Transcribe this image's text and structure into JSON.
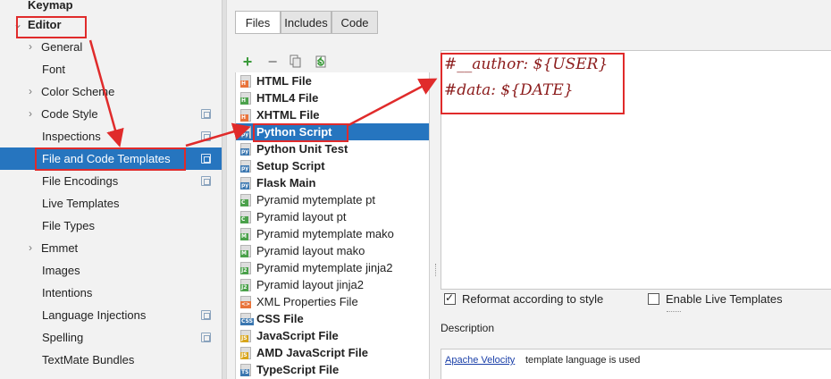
{
  "sidebar": {
    "items": [
      {
        "label": "Keymap",
        "bold": true
      },
      {
        "label": "Editor",
        "bold": true
      },
      {
        "label": "General",
        "chevron": true
      },
      {
        "label": "Font"
      },
      {
        "label": "Color Scheme",
        "chevron": true
      },
      {
        "label": "Code Style",
        "chevron": true,
        "copy_icon": true
      },
      {
        "label": "Inspections",
        "copy_icon": true
      },
      {
        "label": "File and Code Templates",
        "copy_icon": true,
        "selected": true
      },
      {
        "label": "File Encodings",
        "copy_icon": true
      },
      {
        "label": "Live Templates"
      },
      {
        "label": "File Types"
      },
      {
        "label": "Emmet",
        "chevron": true
      },
      {
        "label": "Images"
      },
      {
        "label": "Intentions"
      },
      {
        "label": "Language Injections",
        "copy_icon": true
      },
      {
        "label": "Spelling",
        "copy_icon": true
      },
      {
        "label": "TextMate Bundles"
      }
    ]
  },
  "tabs": [
    {
      "label": "Files",
      "active": true
    },
    {
      "label": "Includes"
    },
    {
      "label": "Code"
    }
  ],
  "toolbar": {
    "add_icon": "plus-icon",
    "remove_icon": "minus-icon",
    "copy_icon": "copy-icon",
    "reset_icon": "reset-icon"
  },
  "templates": [
    {
      "label": "HTML File",
      "bold": true,
      "badge": "H",
      "badge_color": "#e8733a"
    },
    {
      "label": "HTML4 File",
      "bold": true,
      "badge": "H",
      "badge_color": "#4ba14b"
    },
    {
      "label": "XHTML File",
      "bold": true,
      "badge": "H",
      "badge_color": "#e8733a"
    },
    {
      "label": "Python Script",
      "bold": true,
      "badge": "py",
      "badge_color": "#3b77b0",
      "selected": true
    },
    {
      "label": "Python Unit Test",
      "bold": true,
      "badge": "py",
      "badge_color": "#3b77b0"
    },
    {
      "label": "Setup Script",
      "bold": true,
      "badge": "py",
      "badge_color": "#3b77b0"
    },
    {
      "label": "Flask Main",
      "bold": true,
      "badge": "py",
      "badge_color": "#3b77b0"
    },
    {
      "label": "Pyramid mytemplate pt",
      "badge": "C",
      "badge_color": "#4ba14b"
    },
    {
      "label": "Pyramid layout pt",
      "badge": "C",
      "badge_color": "#4ba14b"
    },
    {
      "label": "Pyramid mytemplate mako",
      "badge": "M",
      "badge_color": "#4ba14b"
    },
    {
      "label": "Pyramid layout mako",
      "badge": "M",
      "badge_color": "#4ba14b"
    },
    {
      "label": "Pyramid mytemplate jinja2",
      "badge": "J2",
      "badge_color": "#4ba14b"
    },
    {
      "label": "Pyramid layout jinja2",
      "badge": "J2",
      "badge_color": "#4ba14b"
    },
    {
      "label": "XML Properties File",
      "badge": "<>",
      "badge_color": "#e8733a"
    },
    {
      "label": "CSS File",
      "bold": true,
      "badge": "CSS",
      "badge_color": "#3b77b0"
    },
    {
      "label": "JavaScript File",
      "bold": true,
      "badge": "JS",
      "badge_color": "#d8a51c"
    },
    {
      "label": "AMD JavaScript File",
      "bold": true,
      "badge": "JS",
      "badge_color": "#d8a51c"
    },
    {
      "label": "TypeScript File",
      "bold": true,
      "badge": "TS",
      "badge_color": "#3b77b0"
    }
  ],
  "editor": {
    "lines": [
      {
        "prefix": "#__author",
        "colon": ": ",
        "value": "${USER}"
      },
      {
        "prefix": "#data",
        "colon": ": ",
        "value": "${DATE}"
      }
    ]
  },
  "options": {
    "reformat": {
      "label": "Reformat according to style",
      "checked": true
    },
    "live_templates": {
      "label": "Enable Live Templates",
      "checked": false
    }
  },
  "description": {
    "title": "Description",
    "link": "Apache Velocity",
    "text": "template language is used"
  },
  "annotation_color": "#e02b2b"
}
